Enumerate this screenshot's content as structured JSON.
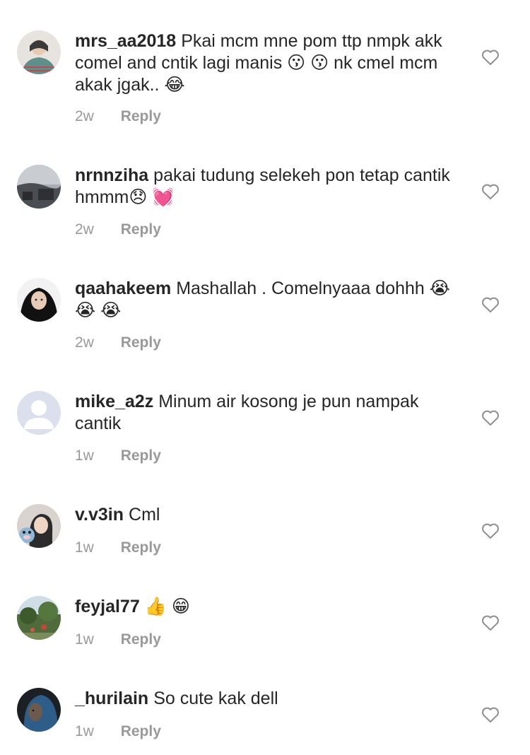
{
  "comments": [
    {
      "username": "mrs_aa2018",
      "text": "Pkai mcm mne pom ttp nmpk akk comel and cntik lagi manis 😗 😗  nk cmel mcm akak jgak.. 😂",
      "time": "2w",
      "reply_label": "Reply",
      "avatar": "woman-in-patterned-scarf-avatar"
    },
    {
      "username": "nrnnziha",
      "text": "pakai tudung selekeh pon tetap cantik hmmm😞 💓",
      "time": "2w",
      "reply_label": "Reply",
      "avatar": "cloudy-sky-building-avatar"
    },
    {
      "username": "qaahakeem",
      "text": "Mashallah . Comelnyaaa dohhh 😭 😭 😭",
      "time": "2w",
      "reply_label": "Reply",
      "avatar": "woman-in-black-hijab-avatar"
    },
    {
      "username": "mike_a2z",
      "text": "Minum air kosong je pun nampak cantik",
      "time": "1w",
      "reply_label": "Reply",
      "avatar": "default-profile-silhouette-avatar"
    },
    {
      "username": "v.v3in",
      "text": "Cml",
      "time": "1w",
      "reply_label": "Reply",
      "avatar": "girl-with-plush-toy-avatar"
    },
    {
      "username": "feyjal77",
      "text": "👍 😁",
      "time": "1w",
      "reply_label": "Reply",
      "avatar": "garden-landscape-avatar"
    },
    {
      "username": "_hurilain",
      "text": "So cute kak dell",
      "time": "1w",
      "reply_label": "Reply",
      "avatar": "woman-in-blue-hijab-avatar"
    }
  ],
  "colors": {
    "text": "#262626",
    "secondary": "#999999",
    "heart_outline": "#8e8e8e",
    "background": "#ffffff"
  }
}
